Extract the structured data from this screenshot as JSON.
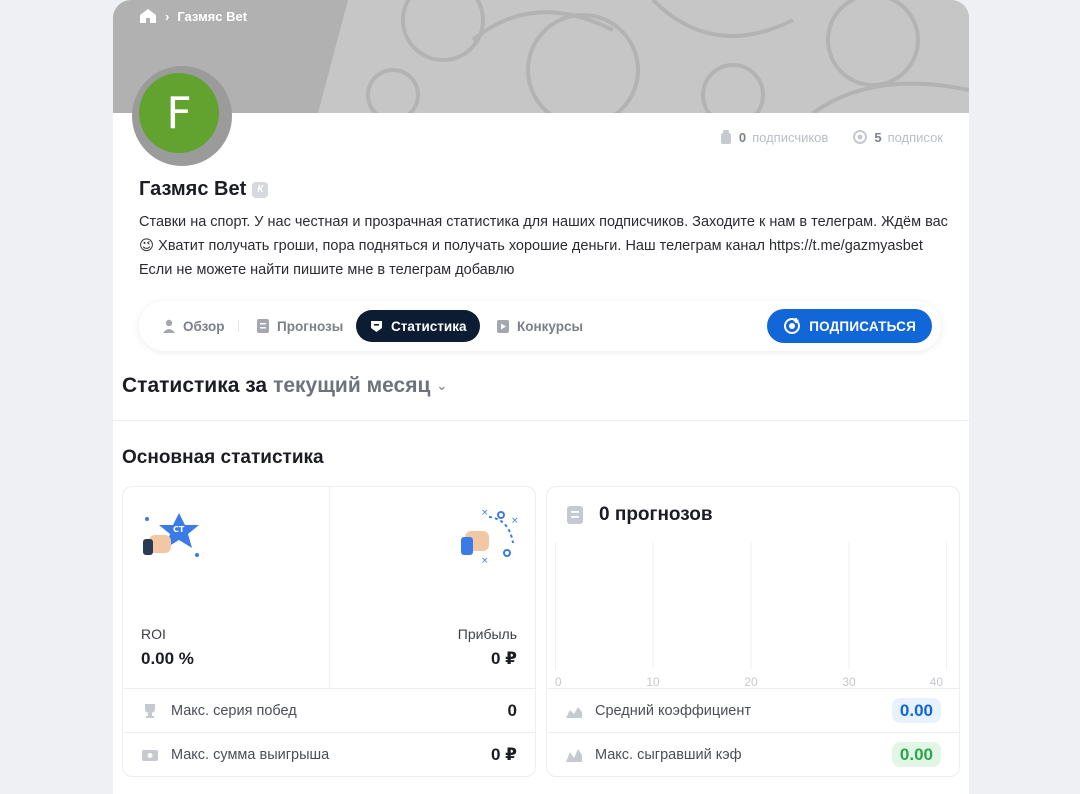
{
  "breadcrumb": {
    "current": "Газмяс Bet"
  },
  "profile": {
    "avatar_letter": "F",
    "name": "Газмяс Bet",
    "badge": "К",
    "subscribers_count": "0",
    "subscribers_label": "подписчиков",
    "subscriptions_count": "5",
    "subscriptions_label": "подписок",
    "description": "Ставки на спорт. У нас честная и прозрачная статистика для наших подписчиков. Заходите к нам в телеграм. Ждём вас😉 Хватит получать гроши, пора подняться и получать хорошие деньги. Наш телеграм канал https://t.me/gazmyasbet Если не можете найти пишите мне в телеграм добавлю"
  },
  "tabs": [
    {
      "label": "Обзор",
      "icon": "user-icon"
    },
    {
      "label": "Прогнозы",
      "icon": "list-icon"
    },
    {
      "label": "Статистика",
      "icon": "stats-icon",
      "active": true
    },
    {
      "label": "Конкурсы",
      "icon": "contest-icon"
    }
  ],
  "subscribe_label": "ПОДПИСАТЬСЯ",
  "period": {
    "prefix": "Статистика за",
    "selected": "текущий месяц"
  },
  "main_stats": {
    "title": "Основная статистика",
    "roi_label": "ROI",
    "roi_value": "0.00 %",
    "profit_label": "Прибыль",
    "profit_value": "0 ₽",
    "max_win_streak_label": "Макс. серия побед",
    "max_win_streak_value": "0",
    "max_win_sum_label": "Макс. сумма выигрыша",
    "max_win_sum_value": "0 ₽"
  },
  "forecasts": {
    "title": "0 прогнозов",
    "avg_coef_label": "Средний коэффициент",
    "avg_coef_value": "0.00",
    "max_coef_label": "Макс. сыгравший кэф",
    "max_coef_value": "0.00"
  },
  "chart_data": {
    "type": "bar",
    "x": [
      0,
      10,
      20,
      30,
      40
    ],
    "tick_labels": [
      "0",
      "10",
      "20",
      "30",
      "40"
    ],
    "values": [],
    "xlim": [
      0,
      40
    ],
    "title": "",
    "grid": true
  },
  "colors": {
    "accent": "#1166d8",
    "active_tab": "#0b1c33",
    "avatar": "#62a32f",
    "positive": "#2aa54a"
  }
}
